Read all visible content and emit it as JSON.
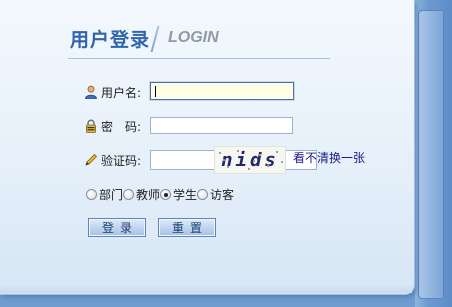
{
  "header": {
    "title_cn": "用户登录",
    "title_en": "LOGIN"
  },
  "form": {
    "username": {
      "label": "用户名:",
      "value": ""
    },
    "password": {
      "label": "密　码:",
      "value": ""
    },
    "captcha": {
      "label": "验证码:",
      "value": "",
      "image_text": "nids",
      "refresh_link": "看不清换一张"
    },
    "roles": [
      {
        "label": "部门",
        "checked": false
      },
      {
        "label": "教师",
        "checked": false
      },
      {
        "label": "学生",
        "checked": true
      },
      {
        "label": "访客",
        "checked": false
      }
    ],
    "login_button": "登录",
    "reset_button": "重置"
  },
  "colors": {
    "title": "#2f66ab",
    "accent": "#6f9dd0"
  },
  "icons": {
    "username": "user-icon",
    "password": "lock-icon",
    "captcha": "pencil-icon"
  }
}
